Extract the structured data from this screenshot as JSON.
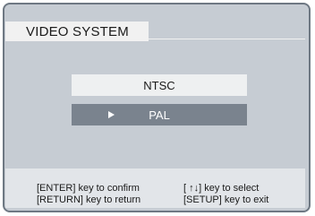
{
  "menu": {
    "title": "VIDEO SYSTEM",
    "options": [
      {
        "label": "NTSC",
        "selected": false
      },
      {
        "label": "PAL",
        "selected": true
      }
    ],
    "selection_marker": "►"
  },
  "help": {
    "enter_confirm": "[ENTER] key to confirm",
    "arrows_select": "[ ↑↓] key to select",
    "return_return": "[RETURN] key to return",
    "setup_exit": "[SETUP] key to exit"
  },
  "colors": {
    "screen_bg": "#c6ccd3",
    "selected_option_bg": "#7a838e",
    "unselected_option_bg": "#eef0f1",
    "help_bar_bg": "#e2e5e9"
  }
}
